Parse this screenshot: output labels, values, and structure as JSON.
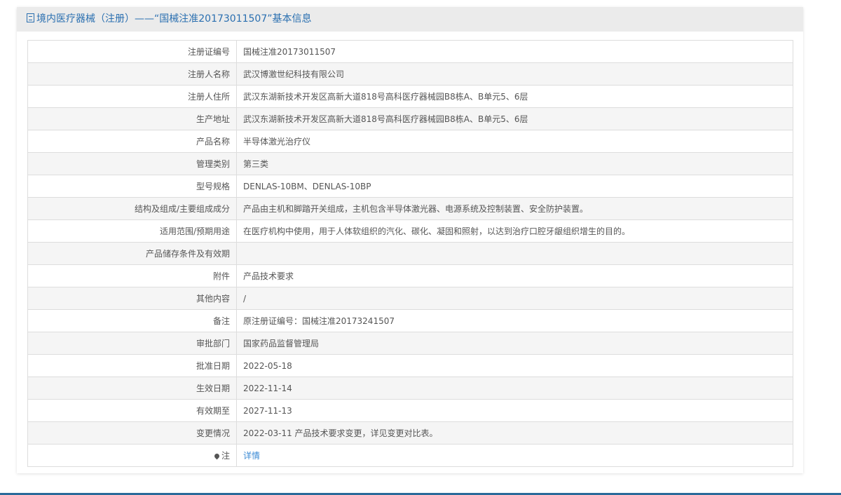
{
  "header": {
    "title": "境内医疗器械（注册）——“国械注准20173011507”基本信息",
    "icon": "document-icon"
  },
  "rows": [
    {
      "label": "注册证编号",
      "value": "国械注准20173011507"
    },
    {
      "label": "注册人名称",
      "value": "武汉博激世纪科技有限公司"
    },
    {
      "label": "注册人住所",
      "value": "武汉东湖新技术开发区高新大道818号高科医疗器械园B8栋A、B单元5、6层"
    },
    {
      "label": "生产地址",
      "value": "武汉东湖新技术开发区高新大道818号高科医疗器械园B8栋A、B单元5、6层"
    },
    {
      "label": "产品名称",
      "value": "半导体激光治疗仪"
    },
    {
      "label": "管理类别",
      "value": "第三类"
    },
    {
      "label": "型号规格",
      "value": "DENLAS-10BM、DENLAS-10BP"
    },
    {
      "label": "结构及组成/主要组成成分",
      "value": "产品由主机和脚踏开关组成，主机包含半导体激光器、电源系统及控制装置、安全防护装置。"
    },
    {
      "label": "适用范围/预期用途",
      "value": "在医疗机构中使用，用于人体软组织的汽化、碳化、凝固和照射，以达到治疗口腔牙龈组织增生的目的。"
    },
    {
      "label": "产品储存条件及有效期",
      "value": ""
    },
    {
      "label": "附件",
      "value": "产品技术要求"
    },
    {
      "label": "其他内容",
      "value": "/"
    },
    {
      "label": "备注",
      "value": "原注册证编号：国械注准20173241507"
    },
    {
      "label": "审批部门",
      "value": "国家药品监督管理局"
    },
    {
      "label": "批准日期",
      "value": "2022-05-18"
    },
    {
      "label": "生效日期",
      "value": "2022-11-14"
    },
    {
      "label": "有效期至",
      "value": "2027-11-13"
    },
    {
      "label": "变更情况",
      "value": "2022-03-11 产品技术要求变更，详见变更对比表。"
    }
  ],
  "note_row": {
    "label": "注",
    "link": "详情",
    "icon": "pin-icon"
  },
  "colors": {
    "accent": "#2a6fb0",
    "link": "#3a8ad4"
  }
}
